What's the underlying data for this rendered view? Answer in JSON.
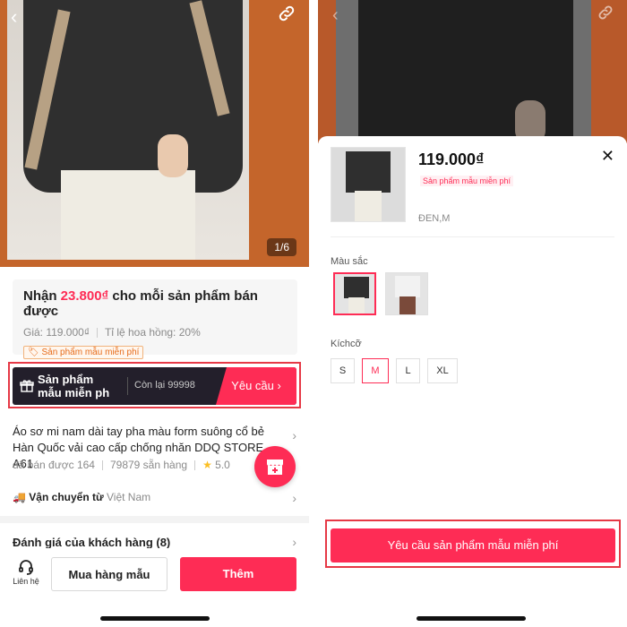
{
  "left": {
    "image_counter": "1/6",
    "commission": {
      "prefix": "Nhận",
      "amount": "23.800₫",
      "suffix": "cho mỗi sản phẩm bán được",
      "price_label": "Giá: 119.000₫",
      "rate_label": "Tỉ lệ hoa hồng: 20%",
      "badge": "Sản phẩm mẫu miễn phí"
    },
    "sample_bar": {
      "label_line1": "Sản phẩm",
      "label_line2": "mẫu miễn ph",
      "remaining": "Còn lại 99998",
      "request": "Yêu cầu"
    },
    "product": {
      "name": "Áo sơ mi nam dài tay pha màu form suông cổ bẻ Hàn Quốc vải cao cấp chống nhăn DDQ STORE A61",
      "sold": "đã bán được 164",
      "stock": "79879 sẵn hàng",
      "rating": "5.0"
    },
    "shipping": {
      "label": "Vận chuyển từ",
      "origin": "Việt Nam"
    },
    "reviews": "Đánh giá của khách hàng (8)",
    "bottom": {
      "contact": "Liên hệ",
      "buy_sample": "Mua hàng mẫu",
      "add": "Thêm"
    }
  },
  "right": {
    "price": "119.000₫",
    "free_tag": "Sản phẩm mẫu miễn phí",
    "variant": "ĐEN,M",
    "color_label": "Màu sắc",
    "colors": [
      {
        "name": "black",
        "shirt": "#2f2f2f",
        "pants": "#efece3",
        "selected": true
      },
      {
        "name": "white",
        "shirt": "#f2f2f2",
        "pants": "#7a4a3a",
        "selected": false
      }
    ],
    "size_label": "Kíchcỡ",
    "sizes": [
      {
        "label": "S",
        "selected": false
      },
      {
        "label": "M",
        "selected": true
      },
      {
        "label": "L",
        "selected": false
      },
      {
        "label": "XL",
        "selected": false
      }
    ],
    "cta": "Yêu cầu sản phẩm mẫu miễn phí"
  },
  "colors": {
    "accent": "#fe2c55",
    "dark_bar": "#231f2b",
    "orange_bg": "#c4652b"
  }
}
